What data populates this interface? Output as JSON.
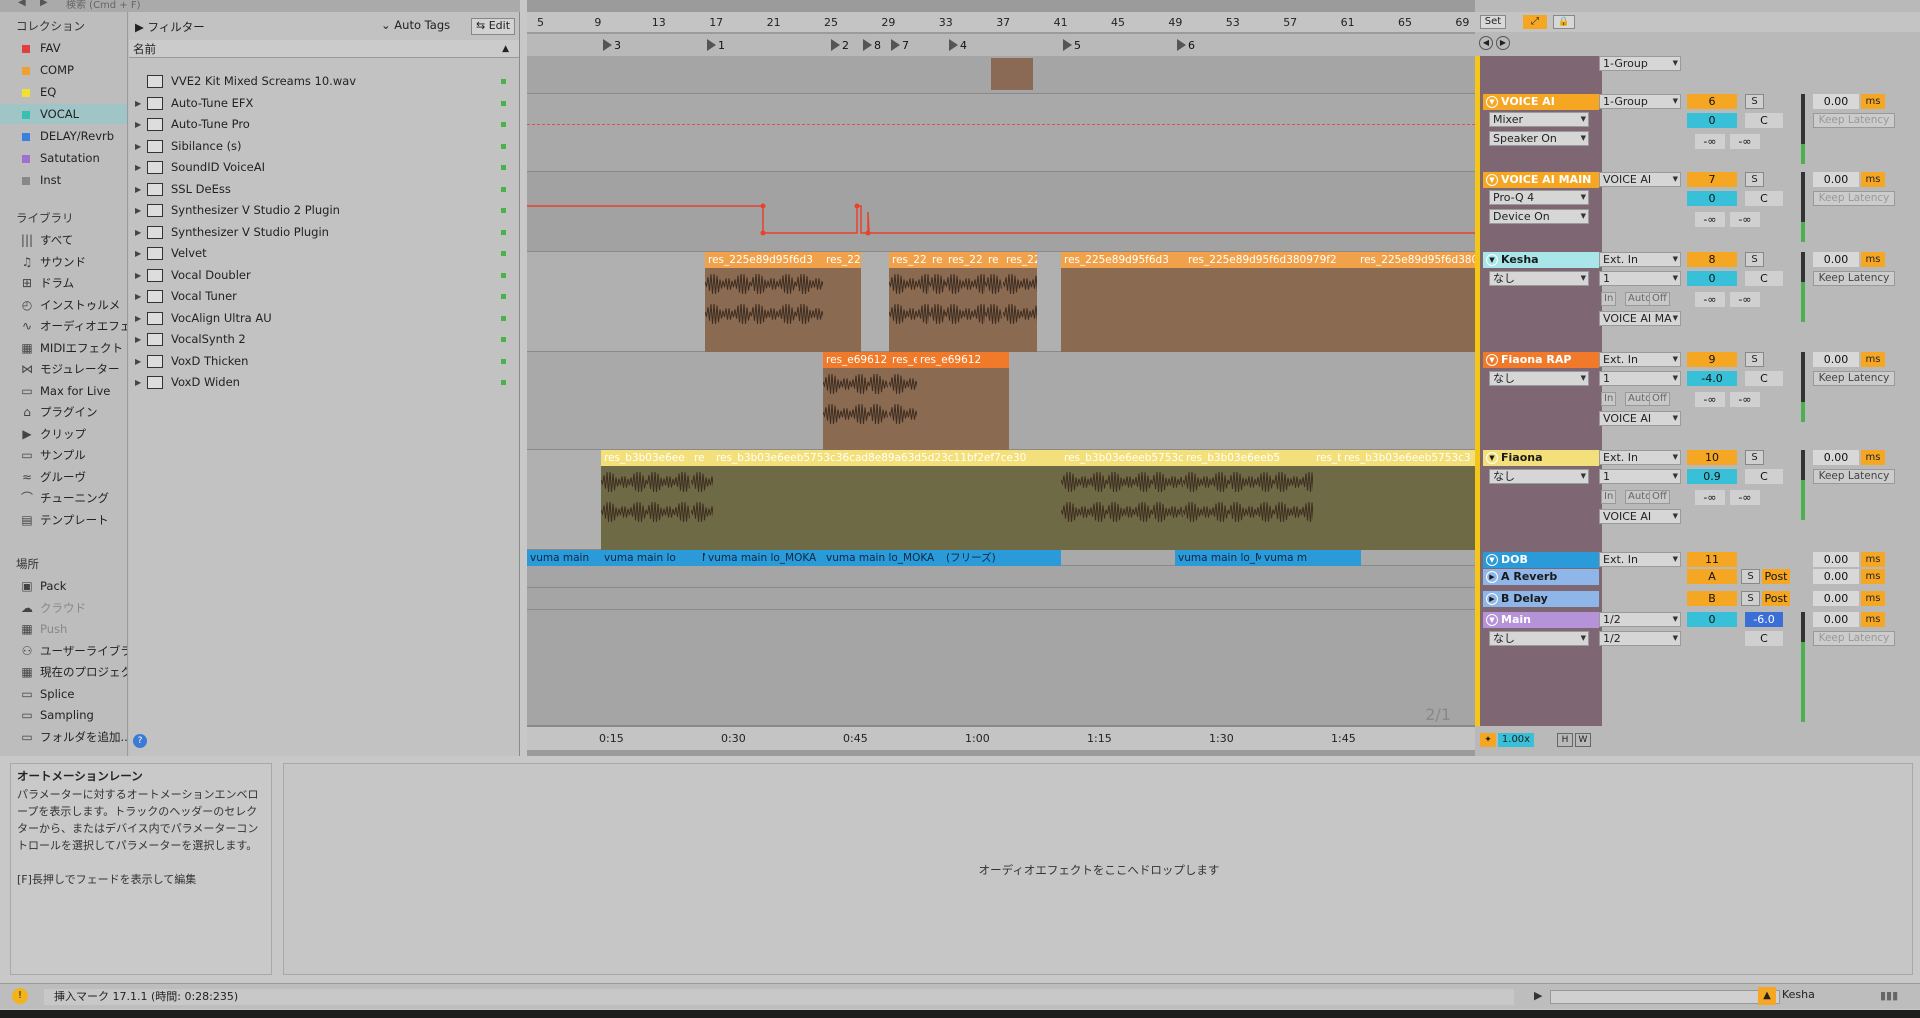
{
  "browser": {
    "search_placeholder": "検索 (Cmd + F)",
    "collections_header": "コレクション",
    "collections": [
      {
        "label": "FAV",
        "color": "#e04040"
      },
      {
        "label": "COMP",
        "color": "#f0a030"
      },
      {
        "label": "EQ",
        "color": "#f0e030"
      },
      {
        "label": "VOCAL",
        "color": "#38c0b0"
      },
      {
        "label": "DELAY/Revrb",
        "color": "#3a80e0"
      },
      {
        "label": "Satutation",
        "color": "#a070d0"
      },
      {
        "label": "Inst",
        "color": "#888888"
      }
    ],
    "library_header": "ライブラリ",
    "library": [
      {
        "label": "すべて",
        "icon": "bars-icon"
      },
      {
        "label": "サウンド",
        "icon": "note-icon"
      },
      {
        "label": "ドラム",
        "icon": "grid-icon"
      },
      {
        "label": "インストゥルメ",
        "icon": "clock-icon"
      },
      {
        "label": "オーディオエフェ",
        "icon": "waveform-icon"
      },
      {
        "label": "MIDIエフェクト",
        "icon": "midi-icon"
      },
      {
        "label": "モジュレーター",
        "icon": "modulator-icon"
      },
      {
        "label": "Max for Live",
        "icon": "max-icon"
      },
      {
        "label": "プラグイン",
        "icon": "plugin-icon"
      },
      {
        "label": "クリップ",
        "icon": "clip-icon"
      },
      {
        "label": "サンプル",
        "icon": "sample-icon"
      },
      {
        "label": "グルーヴ",
        "icon": "groove-icon"
      },
      {
        "label": "チューニング",
        "icon": "tuning-icon"
      },
      {
        "label": "テンプレート",
        "icon": "template-icon"
      }
    ],
    "places_header": "場所",
    "places": [
      {
        "label": "Pack",
        "icon": "pack-icon",
        "dim": false
      },
      {
        "label": "クラウド",
        "icon": "cloud-icon",
        "dim": true
      },
      {
        "label": "Push",
        "icon": "push-icon",
        "dim": true
      },
      {
        "label": "ユーザーライブラ",
        "icon": "user-icon",
        "dim": false
      },
      {
        "label": "現在のプロジェク",
        "icon": "project-icon",
        "dim": false
      },
      {
        "label": "Splice",
        "icon": "folder-icon",
        "dim": false
      },
      {
        "label": "Sampling",
        "icon": "folder-icon",
        "dim": false
      },
      {
        "label": "フォルダを追加...",
        "icon": "add-folder-icon",
        "dim": false
      }
    ],
    "filter_label": "フィルター",
    "autotags_label": "Auto Tags",
    "edit_label": "Edit",
    "name_column": "名前",
    "files": [
      {
        "name": "VVE2 Kit Mixed Screams 10.wav",
        "expandable": false
      },
      {
        "name": "Auto-Tune EFX",
        "expandable": true
      },
      {
        "name": "Auto-Tune Pro",
        "expandable": true
      },
      {
        "name": "Sibilance (s)",
        "expandable": true
      },
      {
        "name": "SoundID VoiceAI",
        "expandable": true
      },
      {
        "name": "SSL DeEss",
        "expandable": true
      },
      {
        "name": "Synthesizer V Studio 2 Plugin",
        "expandable": true
      },
      {
        "name": "Synthesizer V Studio Plugin",
        "expandable": true
      },
      {
        "name": "Velvet",
        "expandable": true
      },
      {
        "name": "Vocal Doubler",
        "expandable": true
      },
      {
        "name": "Vocal Tuner",
        "expandable": true
      },
      {
        "name": "VocAlign Ultra AU",
        "expandable": true
      },
      {
        "name": "VocalSynth 2",
        "expandable": true
      },
      {
        "name": "VoxD Thicken",
        "expandable": true
      },
      {
        "name": "VoxD Widen",
        "expandable": true
      }
    ]
  },
  "arrangement": {
    "ruler": [
      "5",
      "9",
      "13",
      "17",
      "21",
      "25",
      "29",
      "33",
      "37",
      "41",
      "45",
      "49",
      "53",
      "57",
      "61",
      "65",
      "69"
    ],
    "set_label": "Set",
    "locators": [
      {
        "label": "3"
      },
      {
        "label": "1"
      },
      {
        "label": "2"
      },
      {
        "label": "8"
      },
      {
        "label": "7"
      },
      {
        "label": "4"
      },
      {
        "label": "5"
      },
      {
        "label": "6"
      }
    ],
    "time_labels": [
      "0:15",
      "0:30",
      "0:45",
      "1:00",
      "1:15",
      "1:30",
      "1:45"
    ],
    "zoom_label": "2/1",
    "zoom_value": "1.00x",
    "h_label": "H",
    "w_label": "W",
    "clips_kesha": [
      "res_225e89d95f6d3",
      "res_22",
      "res_22",
      "re",
      "res_22",
      "re",
      "res_225",
      "res_225e89d95f6d3",
      "res_225e89d95f6d380979f2",
      "res_225e89d95f6d3809"
    ],
    "clips_fiaona_rap": [
      "res_e69612",
      "res_e69612",
      "res_e69612"
    ],
    "clips_fiaona": [
      "res_b3b03e6ee",
      "re",
      "res_b3b03e6eeb5753c36cad8e89a63d5d23c11bf2ef7ce30",
      "res_b3b03e6eeb5753c",
      "res_b3b03e6eeb5",
      "res_b3b0",
      "res_b3b03e6eeb5753c3"
    ],
    "clips_dob": [
      "vuma main",
      "vuma main lo",
      "M v",
      "vuma main lo_MOKA",
      "vuma main lo_MOKA",
      "(フリーズ)",
      "vuma main lo_MOK",
      "vuma m"
    ]
  },
  "mixer": {
    "tracks": [
      {
        "id": "voice-ai",
        "name": "VOICE AI",
        "color": "#f5a623",
        "input": "1-Group",
        "num": "6",
        "vol": "0",
        "pan": "C",
        "delay": "0.00",
        "latency": "Keep Latency",
        "latency_dim": true,
        "device1": "Mixer",
        "device2": "Speaker On",
        "inf1": "-∞",
        "inf2": "-∞"
      },
      {
        "id": "voice-ai-main",
        "name": "VOICE AI MAIN",
        "color": "#f5a623",
        "input": "VOICE AI",
        "num": "7",
        "vol": "0",
        "pan": "C",
        "delay": "0.00",
        "latency": "Keep Latency",
        "latency_dim": true,
        "device1": "Pro-Q 4",
        "device2": "Device On",
        "inf1": "-∞",
        "inf2": "-∞"
      },
      {
        "id": "kesha",
        "name": "Kesha",
        "color": "#a8e6ea",
        "input": "Ext. In",
        "input_ch": "1",
        "num": "8",
        "vol": "0",
        "pan": "C",
        "delay": "0.00",
        "latency": "Keep Latency",
        "latency_dim": false,
        "monitor": "なし",
        "output": "VOICE AI MA",
        "inf1": "-∞",
        "inf2": "-∞"
      },
      {
        "id": "fiaona-rap",
        "name": "Fiaona RAP",
        "color": "#f07a2a",
        "input": "Ext. In",
        "input_ch": "1",
        "num": "9",
        "vol": "-4.0",
        "pan": "C",
        "delay": "0.00",
        "latency": "Keep Latency",
        "latency_dim": false,
        "monitor": "なし",
        "output": "VOICE AI",
        "inf1": "-∞",
        "inf2": "-∞"
      },
      {
        "id": "fiaona",
        "name": "Fiaona",
        "color": "#f3e07a",
        "input": "Ext. In",
        "input_ch": "1",
        "num": "10",
        "vol": "0.9",
        "pan": "C",
        "delay": "0.00",
        "latency": "Keep Latency",
        "latency_dim": false,
        "monitor": "なし",
        "output": "VOICE AI",
        "inf1": "-∞",
        "inf2": "-∞"
      }
    ],
    "group_top": {
      "input": "1-Group"
    },
    "dob": {
      "name": "DOB",
      "input": "Ext. In",
      "num": "11",
      "delay": "0.00"
    },
    "reverb": {
      "name": "A Reverb",
      "num": "A",
      "post": "Post",
      "delay": "0.00"
    },
    "delay": {
      "name": "B Delay",
      "num": "B",
      "post": "Post",
      "delay": "0.00"
    },
    "main": {
      "name": "Main",
      "ratio1": "1/2",
      "ratio2": "1/2",
      "num": "0",
      "vol": "-6.0",
      "pan": "C",
      "delay": "0.00",
      "latency": "Keep Latency",
      "monitor": "なし"
    },
    "ms_label": "ms",
    "s_label": "S",
    "in_label": "In",
    "auto_label": "Auto",
    "off_label": "Off"
  },
  "info": {
    "title": "オートメーションレーン",
    "body": "パラメーターに対するオートメーションエンベロープを表示します。トラックのヘッダーのセレクターから、またはデバイス内でパラメーターコントロールを選択してパラメーターを選択します。",
    "note": "[F]長押しでフェードを表示して編集"
  },
  "device_panel": {
    "drop_hint": "オーディオエフェクトをここへドロップします"
  },
  "status": {
    "text": "挿入マーク 17.1.1 (時間: 0:28:235)",
    "track_name": "Kesha"
  }
}
